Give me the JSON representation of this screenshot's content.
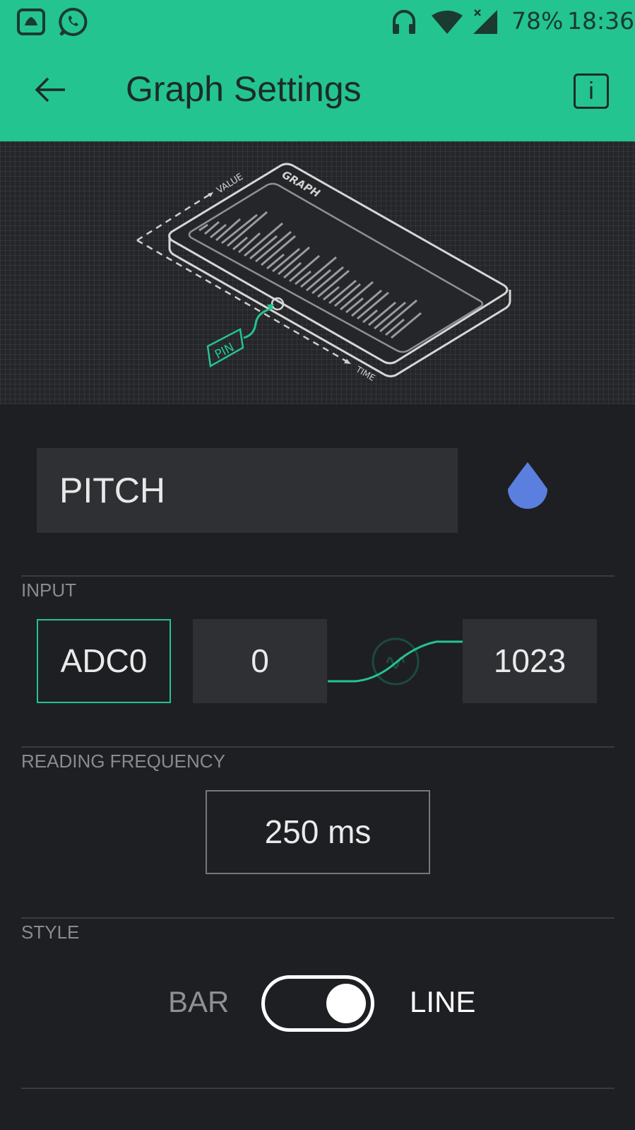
{
  "status_bar": {
    "battery": "78%",
    "time": "18:36"
  },
  "header": {
    "title": "Graph Settings",
    "info_label": "i"
  },
  "illustration": {
    "value_label": "VALUE",
    "graph_label": "GRAPH",
    "time_label": "TIME",
    "pin_label": "PIN"
  },
  "widget": {
    "name": "PITCH",
    "color": "#5b7fde"
  },
  "input": {
    "section_label": "INPUT",
    "pin": "ADC0",
    "min": "0",
    "max": "1023"
  },
  "frequency": {
    "section_label": "READING FREQUENCY",
    "value": "250 ms"
  },
  "style": {
    "section_label": "STYLE",
    "option_left": "BAR",
    "option_right": "LINE",
    "selected": "LINE"
  },
  "colors": {
    "accent": "#23c48f",
    "background": "#1e1f23"
  }
}
